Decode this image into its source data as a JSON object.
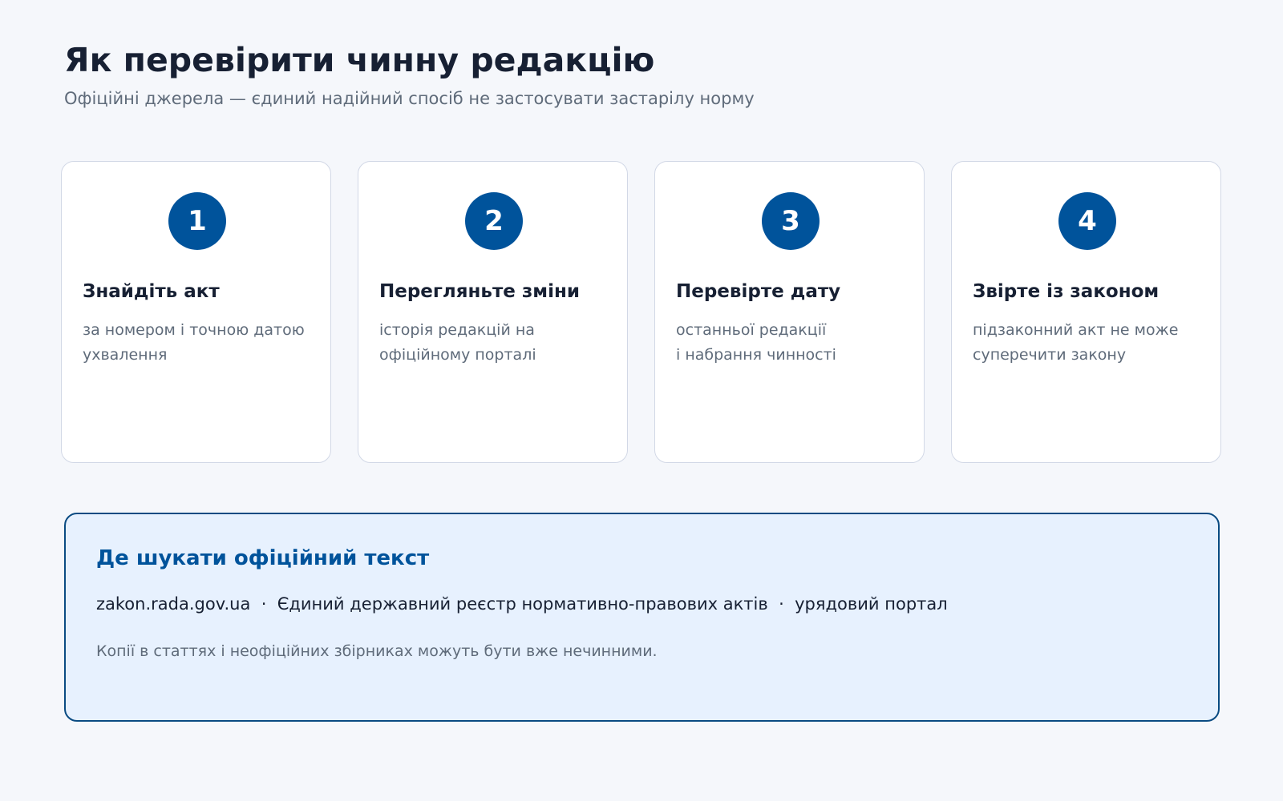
{
  "header": {
    "title": "Як перевірити чинну редакцію",
    "subtitle": "Офіційні джерела — єдиний надійний спосіб не застосувати застарілу норму"
  },
  "steps": [
    {
      "number": "1",
      "title": "Знайдіть акт",
      "desc_lines": [
        "за номером і точною датою",
        "ухвалення"
      ]
    },
    {
      "number": "2",
      "title": "Перегляньте зміни",
      "desc_lines": [
        "історія редакцій на",
        "офіційному порталі"
      ]
    },
    {
      "number": "3",
      "title": "Перевірте дату",
      "desc_lines": [
        "останньої редакції",
        "і набрання чинності"
      ]
    },
    {
      "number": "4",
      "title": "Звірте із законом",
      "desc_lines": [
        "підзаконний акт не може",
        "суперечити закону"
      ]
    }
  ],
  "sources": {
    "title": "Де шукати офіційний текст",
    "list": "zakon.rada.gov.ua  ·  Єдиний державний реєстр нормативно-правових актів  ·  урядовий портал",
    "note": "Копії в статтях і неофіційних збірниках можуть бути вже нечинними."
  },
  "colors": {
    "accent": "#00539b",
    "background": "#f5f7fb",
    "card": "#ffffff",
    "card_border": "#d2d8e6",
    "box_background": "#e7f1fe",
    "box_border": "#0a4b82",
    "heading": "#172033",
    "muted": "#5f6b7a"
  }
}
